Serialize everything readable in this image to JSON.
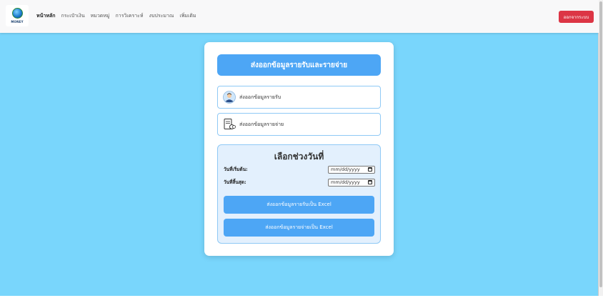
{
  "navbar": {
    "logo_text": "MONEY",
    "links": [
      {
        "label": "หน้าหลัก",
        "active": true
      },
      {
        "label": "กระเป๋าเงิน",
        "active": false
      },
      {
        "label": "หมวดหมู่",
        "active": false
      },
      {
        "label": "การวิเคราะห์",
        "active": false
      },
      {
        "label": "งบประมาณ",
        "active": false
      },
      {
        "label": "เพิ่มเติม",
        "active": false
      }
    ],
    "logout_label": "ออกจากระบบ"
  },
  "card": {
    "title": "ส่งออกข้อมูลรายรับและรายจ่าย",
    "options": [
      {
        "label": "ส่งออกข้อมูลรายรับ",
        "icon": "user-icon"
      },
      {
        "label": "ส่งออกข้อมูลรายจ่าย",
        "icon": "document-icon"
      }
    ],
    "date_panel": {
      "title": "เลือกช่วงวันที่",
      "start_label": "วันที่เริ่มต้น:",
      "start_placeholder": "mm/dd/yyyy",
      "end_label": "วันที่สิ้นสุด:",
      "end_placeholder": "mm/dd/yyyy",
      "export_income_label": "ส่งออกข้อมูลรายรับเป็น Excel",
      "export_expense_label": "ส่งออกข้อมูลรายจ่ายเป็น Excel"
    }
  },
  "colors": {
    "background": "#79d6fc",
    "primary": "#4da6f5",
    "danger": "#dc3545",
    "panel": "#e3f0fd"
  }
}
